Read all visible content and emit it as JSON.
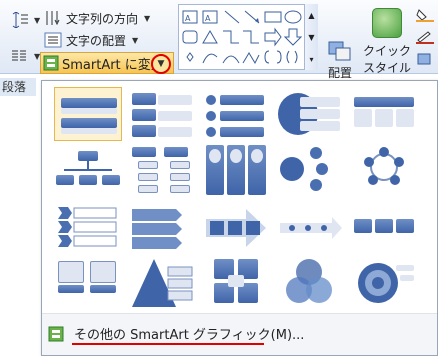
{
  "ribbon": {
    "text_direction_label": "文字列の方向",
    "text_align_label": "文字の配置",
    "smartart_label": "SmartArt に変換",
    "group_label": "段落",
    "arrange_label": "配置",
    "quick_style_line1": "クイック",
    "quick_style_line2": "スタイル"
  },
  "menu": {
    "more_smartart_label": "その他の SmartArt グラフィック(M)..."
  }
}
